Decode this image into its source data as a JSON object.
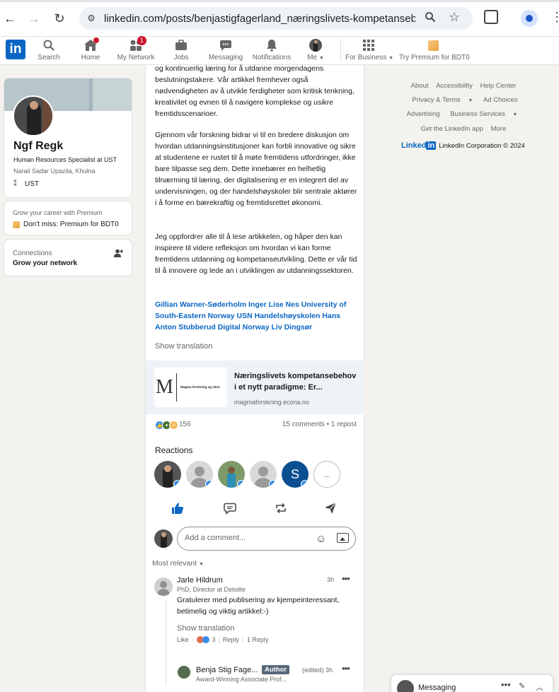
{
  "browser": {
    "url": "linkedin.com/posts/benjastigfagerland_næringslivets-kompetansebeh..."
  },
  "nav": {
    "logo": "in",
    "items": [
      {
        "label": "Search",
        "badge": ""
      },
      {
        "label": "Home",
        "badge": ""
      },
      {
        "label": "My Network",
        "badge": "1"
      },
      {
        "label": "Jobs",
        "badge": ""
      },
      {
        "label": "Messaging",
        "badge": ""
      },
      {
        "label": "Notifications",
        "badge": ""
      },
      {
        "label": "Me",
        "badge": ""
      },
      {
        "label": "For Business",
        "badge": ""
      },
      {
        "label": "Try Premium for BDT0",
        "badge": ""
      }
    ]
  },
  "profile": {
    "name": "Ngf Regk",
    "headline": "Human Resources Specialist at UST",
    "location": "Narail Sadar Upazila, Khulna",
    "company": "UST"
  },
  "premium_card": {
    "line1": "Grow your career with Premium",
    "line2": "Don't miss: Premium for BDT0"
  },
  "connections_card": {
    "line1": "Connections",
    "line2": "Grow your network"
  },
  "post": {
    "para1": "og kontinuerlig læring for å utdanne morgendagens beslutningstakere. Vår artikkel fremhever også nødvendigheten av å utvikle ferdigheter som kritisk tenkning, kreativitet og evnen til å navigere komplekse og usikre fremtidsscenarioer.",
    "para2": "Gjennom vår forskning bidrar vi til en bredere diskusjon om hvordan utdanningsinstitusjoner kan forbli innovative og sikre at studentene er rustet til å møte fremtidens utfordringer, ikke bare tilpasse seg dem. Dette innebærer en helhetlig tilnærming til læring, der digitalisering er en integrert del av undervisningen, og der handelshøyskoler blir sentrale aktører i å forme en bærekraftig og fremtidsrettet økonomi.",
    "para3": "Jeg oppfordrer alle til å lese artikkelen, og håper den kan inspirere til videre refleksjon om hvordan vi kan forme fremtidens utdanning og kompetanseutvikling. Dette er vår tid til å innovere og lede an i utviklingen av utdanningssektoren.",
    "tags": "Gillian Warner-Søderholm Inger Lise Nes University of South-Eastern Norway USN Handelshøyskolen Hans Anton Stubberud Digital Norway Liv Dingsør",
    "show_translation": "Show translation",
    "article": {
      "thumb_letter": "M",
      "thumb_text": "Magma forskning og viten",
      "title": "Næringslivets kompetansebehov i et nytt paradigme: Er...",
      "source": "magmaforskning.econa.no"
    },
    "reaction_count": "156",
    "comments_reposts": "15 comments • 1 repost",
    "reactions_heading": "Reactions",
    "reactor_letter": "S",
    "more_reactors": "...",
    "comment_placeholder": "Add a comment...",
    "sort_label": "Most relevant"
  },
  "comment": {
    "name": "Jarle Hildrum",
    "headline": "PhD, Director at Deloitte",
    "time": "3h",
    "text": "Gratulerer med publisering av kjempeinteressant, betimelig og viktig artikkel:-)",
    "show_translation": "Show translation",
    "like": "Like",
    "reaction_count": "3",
    "reply": "Reply",
    "reply_count": "1 Reply"
  },
  "reply": {
    "name": "Benja Stig Fage...",
    "badge": "Author",
    "time": "(edited) 3h",
    "headline": "Award-Winning Associate Prof..."
  },
  "footer": {
    "links": [
      "About",
      "Accessibility",
      "Help Center",
      "Privacy & Terms",
      "Ad Choices",
      "Advertising",
      "Business Services",
      "Get the LinkedIn app",
      "More"
    ],
    "brand": "Linked",
    "brand_in": "in",
    "copyright": "LinkedIn Corporation © 2024"
  },
  "messaging": {
    "label": "Messaging"
  },
  "colors": {
    "linkedin_blue": "#0a66c2",
    "badge_red": "#cb112d",
    "page_bg": "#f4f2ee",
    "author_badge": "#56687a"
  }
}
